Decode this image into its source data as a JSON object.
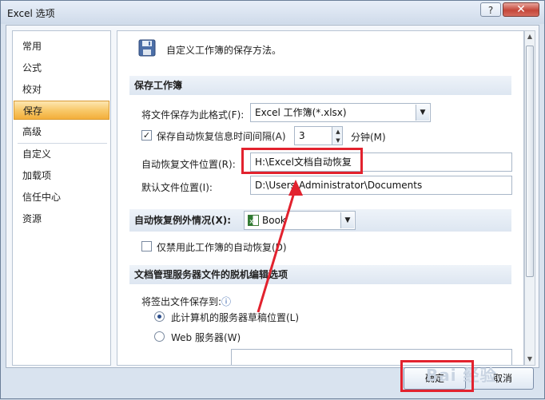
{
  "window": {
    "title": "Excel 选项",
    "help_glyph": "?",
    "close_glyph": "✕"
  },
  "sidebar": {
    "items": [
      {
        "label": "常用"
      },
      {
        "label": "公式"
      },
      {
        "label": "校对"
      },
      {
        "label": "保存",
        "selected": true
      },
      {
        "label": "高级"
      },
      {
        "label": "自定义"
      },
      {
        "label": "加载项"
      },
      {
        "label": "信任中心"
      },
      {
        "label": "资源"
      }
    ]
  },
  "header": {
    "icon": "save-disk-icon",
    "text": "自定义工作簿的保存方法。"
  },
  "save_workbooks": {
    "section_title": "保存工作簿",
    "format_label": "将文件保存为此格式(F):",
    "format_value": "Excel 工作簿(*.xlsx)",
    "autorecover_label": "保存自动恢复信息时间间隔(A)",
    "autorecover_checked": true,
    "autorecover_minutes": "3",
    "minutes_unit": "分钟(M)",
    "autorecover_location_label": "自动恢复文件位置(R):",
    "autorecover_location_value": "H:\\Excel文档自动恢复",
    "default_location_label": "默认文件位置(I):",
    "default_location_value": "D:\\Users\\Administrator\\Documents"
  },
  "autorecover_exceptions": {
    "section_title": "自动恢复例外情况(X):",
    "workbook_value": "Book",
    "workbook_icon": "excel-book-icon",
    "disable_label": "仅禁用此工作簿的自动恢复(D)",
    "disable_checked": false
  },
  "offline_editing": {
    "section_title": "文档管理服务器文件的脱机编辑选项",
    "save_to_label": "将签出文件保存到:",
    "info_glyph": "ⓘ",
    "option_local_label": "此计算机的服务器草稿位置(L)",
    "option_local_selected": true,
    "option_web_label": "Web 服务器(W)",
    "option_web_selected": false
  },
  "footer": {
    "ok_label": "确定",
    "cancel_label": "取消"
  },
  "watermark": "Bai 经验",
  "colors": {
    "highlight": "#e2222e",
    "selected_nav": "#f8c96b"
  }
}
